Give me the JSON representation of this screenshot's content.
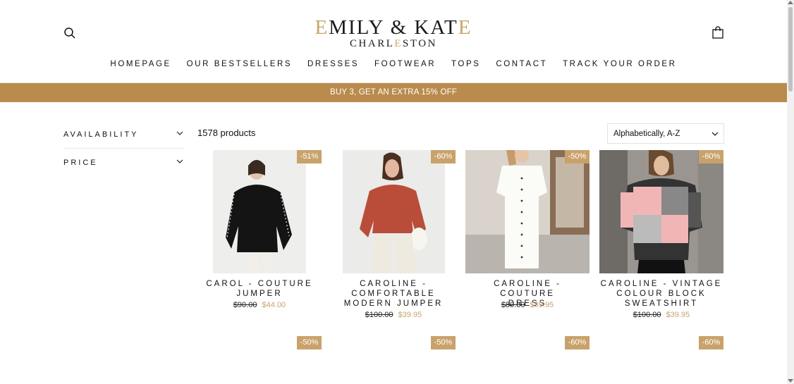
{
  "header": {
    "logo_main_first": "E",
    "logo_main_mid": "MILY & KAT",
    "logo_main_last": "E",
    "logo_sub_a": "CHARL",
    "logo_sub_accent": "E",
    "logo_sub_b": "STON",
    "nav": [
      "HOMEPAGE",
      "OUR BESTSELLERS",
      "DRESSES",
      "FOOTWEAR",
      "TOPS",
      "CONTACT",
      "TRACK YOUR ORDER"
    ],
    "icons": {
      "search": "search-icon",
      "cart": "shopping-bag-icon"
    }
  },
  "banner": {
    "text": "BUY 3, GET AN EXTRA 15% OFF",
    "color": "#b98b4c"
  },
  "filters": [
    {
      "label": "AVAILABILITY"
    },
    {
      "label": "PRICE"
    }
  ],
  "toolbar": {
    "count": "1578 products",
    "sort": "Alphabetically, A-Z"
  },
  "products": [
    {
      "badge": "-51%",
      "title_lines": [
        "CAROL - COUTURE",
        "JUMPER"
      ],
      "old_price": "$90.00",
      "new_price": "$44.00"
    },
    {
      "badge": "-60%",
      "title_lines": [
        "CAROLINE -",
        "COMFORTABLE",
        "MODERN JUMPER"
      ],
      "old_price": "$100.00",
      "new_price": "$39.95"
    },
    {
      "badge": "-50%",
      "title_lines": [
        "CAROLINE - COUTURE",
        "DRESS"
      ],
      "old_price": "$80.00",
      "new_price": "$39.95"
    },
    {
      "badge": "-60%",
      "title_lines": [
        "CAROLINE - VINTAGE",
        "COLOUR BLOCK",
        "SWEATSHIRT"
      ],
      "old_price": "$100.00",
      "new_price": "$39.95"
    }
  ],
  "second_row_badges": [
    "-50%",
    "-50%",
    "-60%",
    "-60%"
  ],
  "colors": {
    "accent": "#c9a26b",
    "banner": "#b98b4c"
  }
}
